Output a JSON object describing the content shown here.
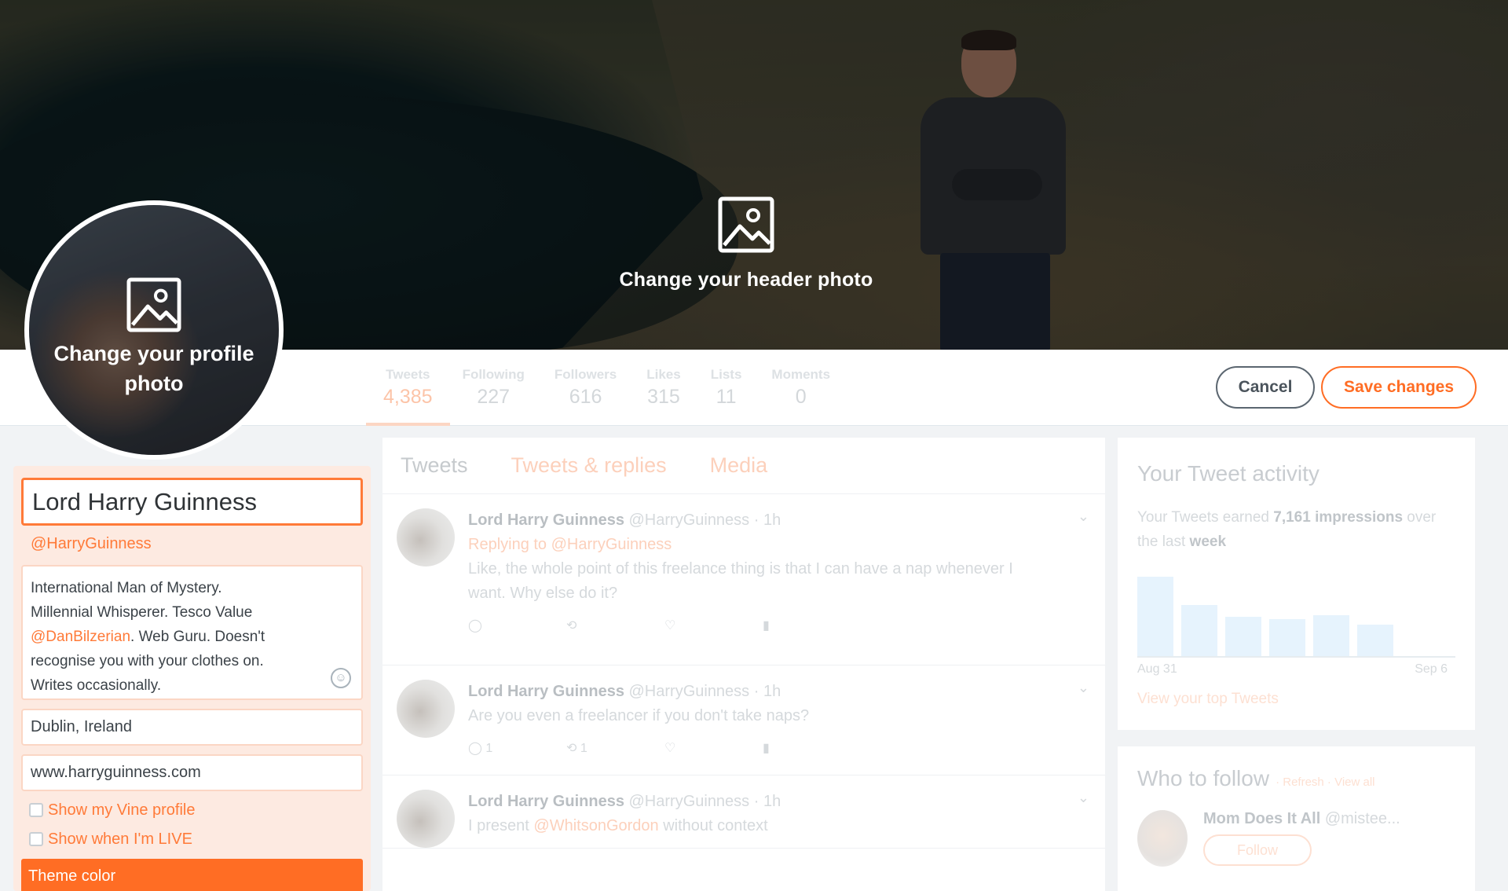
{
  "header": {
    "change_label": "Change your header photo",
    "icon": "image-icon"
  },
  "avatar": {
    "change_label_line1": "Change your profile",
    "change_label_line2": "photo",
    "icon": "image-icon"
  },
  "stats": [
    {
      "label": "Tweets",
      "value": "4,385"
    },
    {
      "label": "Following",
      "value": "227"
    },
    {
      "label": "Followers",
      "value": "616"
    },
    {
      "label": "Likes",
      "value": "315"
    },
    {
      "label": "Lists",
      "value": "11"
    },
    {
      "label": "Moments",
      "value": "0"
    }
  ],
  "buttons": {
    "cancel": "Cancel",
    "save": "Save changes"
  },
  "edit": {
    "name": "Lord Harry Guinness",
    "handle": "@HarryGuinness",
    "bio_line1": "International Man of Mystery.",
    "bio_line2": "Millennial Whisperer. Tesco Value",
    "bio_mention": "@DanBilzerian",
    "bio_line3_rest": ". Web Guru. Doesn't",
    "bio_line4": "recognise you with your clothes on.",
    "bio_line5": "Writes occasionally.",
    "location": "Dublin, Ireland",
    "website": "www.harryguinness.com",
    "vine_label": "Show my Vine profile",
    "live_label": "Show when I'm LIVE",
    "theme_color_label": "Theme color",
    "colors": {
      "accent": "#ff6d24",
      "panel": "#fdeae1"
    }
  },
  "timeline": {
    "tabs": [
      "Tweets",
      "Tweets & replies",
      "Media"
    ],
    "tweets": [
      {
        "name": "Lord Harry Guinness",
        "handle_time": "@HarryGuinness · 1h",
        "reply_prefix": "Replying to",
        "reply_to": "@HarryGuinness",
        "text_line1": "Like, the whole point of this freelance thing is that I can have a nap whenever I",
        "text_line2": "want. Why else do it?"
      },
      {
        "name": "Lord Harry Guinness",
        "handle_time": "@HarryGuinness · 1h",
        "text": "Are you even a freelancer if you don't take naps?",
        "reply_count": "1",
        "retweet_count": "1"
      },
      {
        "name": "Lord Harry Guinness",
        "handle_time": "@HarryGuinness · 1h",
        "text_prefix": "I present",
        "mention": "@WhitsonGordon",
        "text_suffix": "without context"
      }
    ]
  },
  "activity": {
    "title": "Your Tweet activity",
    "text_prefix": "Your Tweets earned",
    "impressions": "7,161 impressions",
    "text_suffix": "over the last",
    "period": "week",
    "bars": [
      0.9,
      0.58,
      0.45,
      0.42,
      0.46,
      0.36
    ],
    "start_date": "Aug 31",
    "end_date": "Sep 6",
    "top_link": "View your top Tweets"
  },
  "who_to_follow": {
    "title": "Who to follow",
    "refresh": "· Refresh · View all",
    "suggestion_name": "Mom Does It All",
    "suggestion_handle": "@mistee...",
    "follow_label": "Follow"
  }
}
